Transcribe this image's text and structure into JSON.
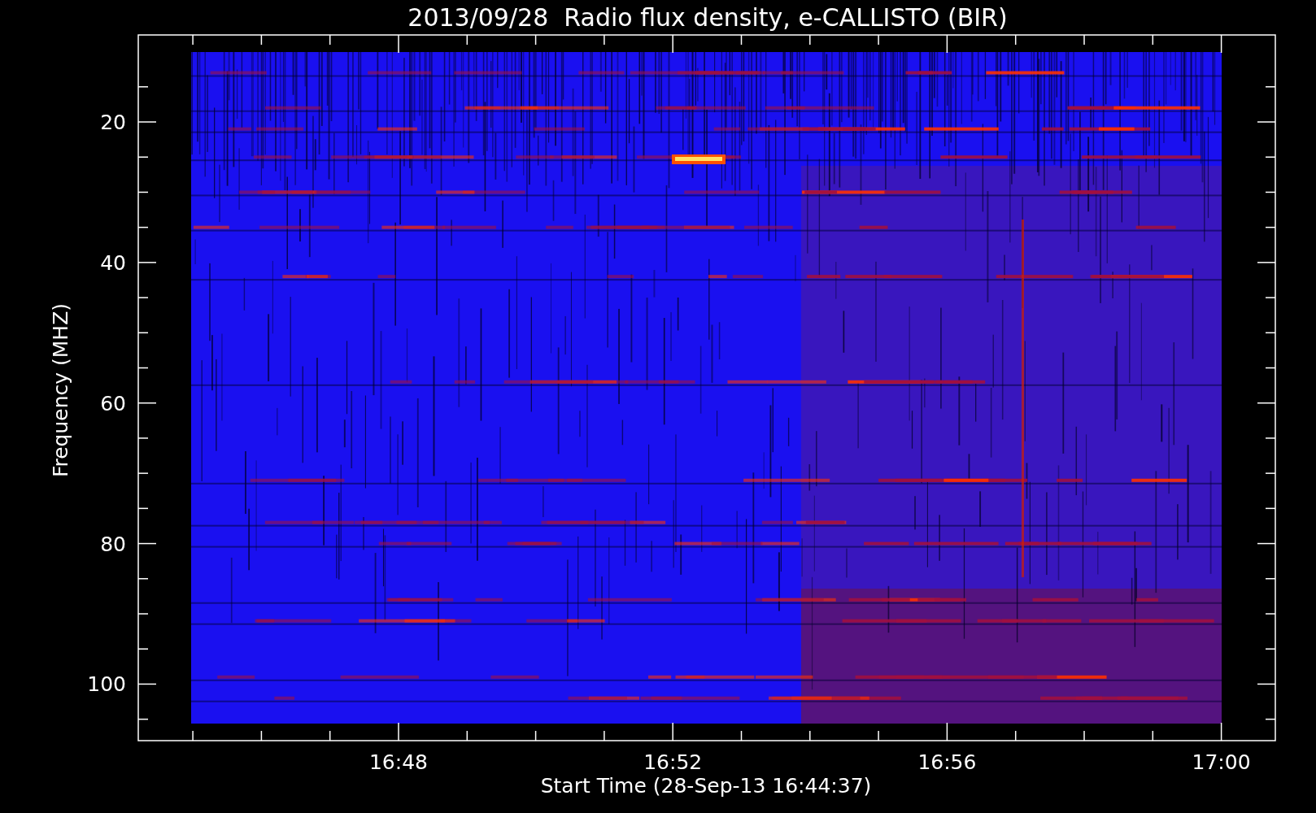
{
  "title": "2013/09/28  Radio flux density, e-CALLISTO (BIR)",
  "y_axis": {
    "label": "Frequency (MHZ)",
    "ticks": [
      "20",
      "40",
      "60",
      "80",
      "100"
    ]
  },
  "x_axis": {
    "label": "Start Time (28-Sep-13 16:44:37)",
    "ticks": [
      "16:48",
      "16:52",
      "16:56",
      "17:00"
    ]
  }
}
